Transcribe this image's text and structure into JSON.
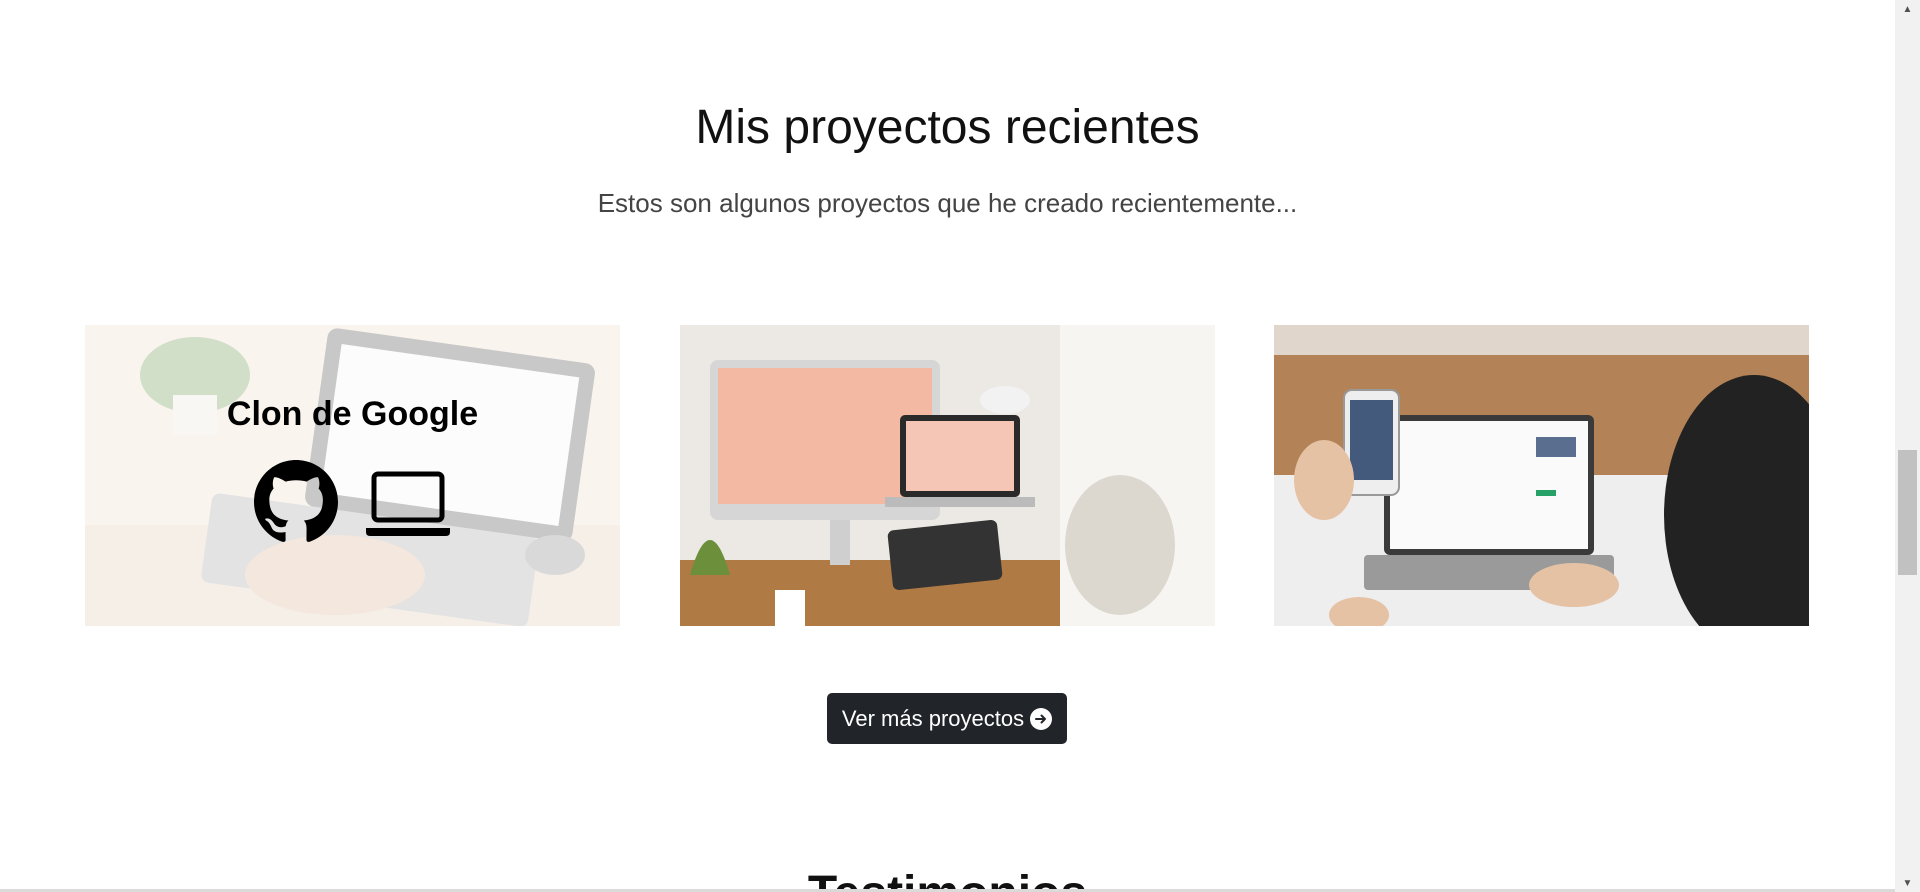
{
  "section": {
    "title": "Mis proyectos recientes",
    "subtitle": "Estos son algunos proyectos que he creado recientemente..."
  },
  "projects": [
    {
      "caption": "Clon de Google",
      "icons": [
        "github-icon",
        "laptop-icon"
      ]
    },
    {
      "caption": ""
    },
    {
      "caption": ""
    }
  ],
  "button": {
    "label": "Ver más proyectos",
    "icon": "arrow-right-circle-icon"
  },
  "next_section": {
    "title": "Testimonios"
  },
  "colors": {
    "button_bg": "#212529",
    "title": "#111111",
    "subtitle": "#444444"
  }
}
